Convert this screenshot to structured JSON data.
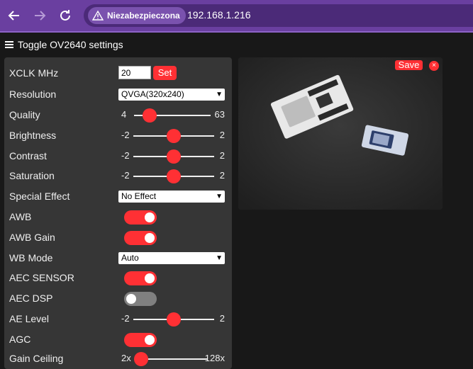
{
  "browser": {
    "security_label": "Niezabezpieczona",
    "url": "192.168.1.216"
  },
  "header": {
    "toggle_label": "Toggle OV2640 settings"
  },
  "settings": {
    "xclk": {
      "label": "XCLK MHz",
      "value": "20",
      "button": "Set"
    },
    "resolution": {
      "label": "Resolution",
      "value": "QVGA(320x240)"
    },
    "quality": {
      "label": "Quality",
      "min": "4",
      "max": "63",
      "level": 0.2
    },
    "brightness": {
      "label": "Brightness",
      "min": "-2",
      "max": "2",
      "level": 0.5
    },
    "contrast": {
      "label": "Contrast",
      "min": "-2",
      "max": "2",
      "level": 0.5
    },
    "saturation": {
      "label": "Saturation",
      "min": "-2",
      "max": "2",
      "level": 0.5
    },
    "special_effect": {
      "label": "Special Effect",
      "value": "No Effect"
    },
    "awb": {
      "label": "AWB",
      "on": true
    },
    "awb_gain": {
      "label": "AWB Gain",
      "on": true
    },
    "wb_mode": {
      "label": "WB Mode",
      "value": "Auto"
    },
    "aec_sensor": {
      "label": "AEC SENSOR",
      "on": true
    },
    "aec_dsp": {
      "label": "AEC DSP",
      "on": false
    },
    "ae_level": {
      "label": "AE Level",
      "min": "-2",
      "max": "2",
      "level": 0.5
    },
    "agc": {
      "label": "AGC",
      "on": true
    },
    "gain_ceiling": {
      "label": "Gain Ceiling",
      "min": "2x",
      "max": "128x",
      "level": 0.0
    }
  },
  "stream": {
    "save_label": "Save",
    "close_label": "×"
  },
  "colors": {
    "accent": "#ff3034",
    "panel": "#363636",
    "background": "#181818",
    "browser_bar": "#6a3fa0"
  }
}
